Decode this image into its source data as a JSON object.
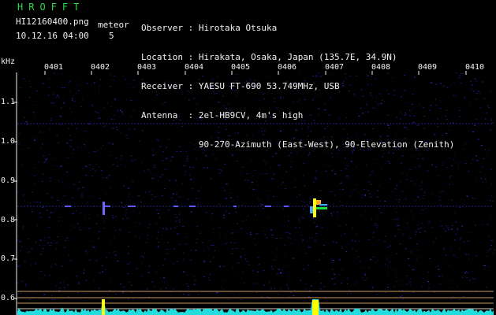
{
  "header": {
    "app_title": "HROFFT",
    "filename": "HI12160400.png",
    "datetime": "10.12.16 04:00",
    "meteor_label": "meteor",
    "meteor_count": "5"
  },
  "station": [
    {
      "label": "Observer",
      "value": "Hirotaka Otsuka"
    },
    {
      "label": "Location",
      "value": "Hirakata, Osaka, Japan (135.7E, 34.9N)"
    },
    {
      "label": "Receiver",
      "value": "YAESU FT-690 53.749MHz, USB"
    },
    {
      "label": "Antenna",
      "value": "2el-HB9CV, 4m's high"
    },
    {
      "label": "",
      "value": "90-270-Azimuth (East-West), 90-Elevation (Zenith)"
    }
  ],
  "axes": {
    "y_unit": "kHz",
    "y_ticks": [
      "1.1",
      "1.0",
      "0.9",
      "0.8",
      "0.7",
      "0.6"
    ],
    "x_ticks": [
      "0401",
      "0402",
      "0403",
      "0404",
      "0405",
      "0406",
      "0407",
      "0408",
      "0409",
      "0410"
    ]
  },
  "colors": {
    "background": "#000000",
    "text": "#f2f2f2",
    "title": "#22dd44",
    "noise": "#1a1a80",
    "echo": "#ffff00",
    "spectrum": "#22dddd"
  }
}
